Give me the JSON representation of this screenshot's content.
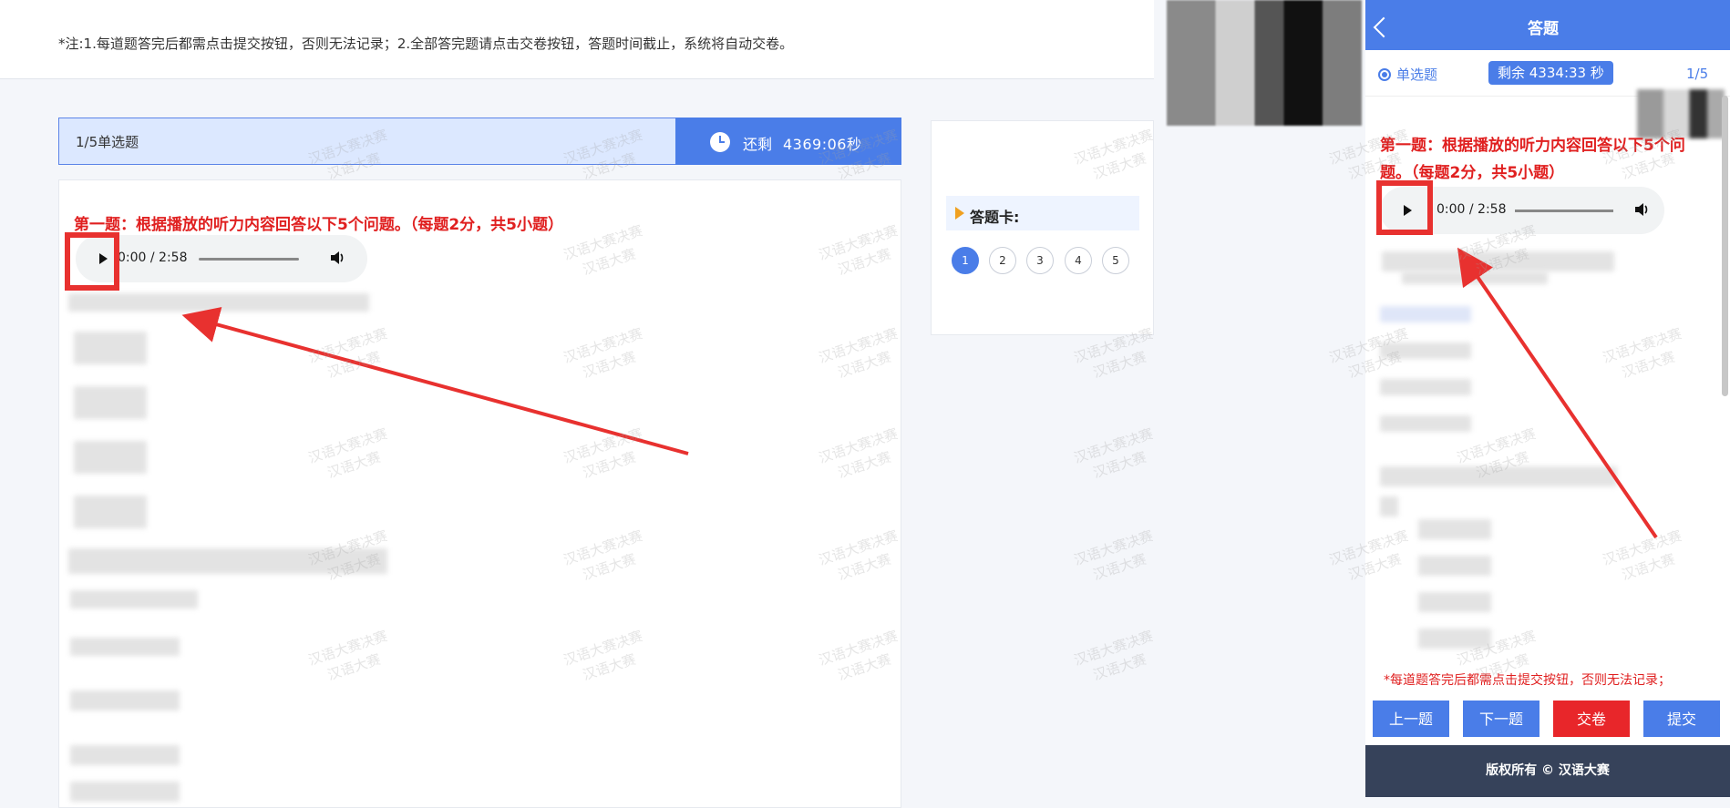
{
  "notice": {
    "text": "*注:1.每道题答完后都需点击提交按钮，否则无法记录；2.全部答完题请点击交卷按钮，答题时间截止，系统将自动交卷。"
  },
  "desktop": {
    "question_type": "1/5单选题",
    "timer_label": "还剩",
    "timer_value": "4369:06秒",
    "question_title": "第一题：根据播放的听力内容回答以下5个问题。（每题2分，共5小题）",
    "audio_time": "0:00 / 2:58",
    "answer_card_title": "答题卡:",
    "answer_card_numbers": [
      "1",
      "2",
      "3",
      "4",
      "5"
    ],
    "active_question": "1"
  },
  "mobile": {
    "header_title": "答题",
    "question_type": "单选题",
    "remaining": "剩余 4334:33 秒",
    "progress": "1/5",
    "question_title": "第一题：根据播放的听力内容回答以下5个问题。（每题2分，共5小题）",
    "audio_time": "0:00 / 2:58",
    "note": "*每道题答完后都需点击提交按钮，否则无法记录；",
    "buttons": {
      "prev": "上一题",
      "next": "下一题",
      "submit_paper": "交卷",
      "submit": "提交"
    },
    "footer": "版权所有 © 汉语大赛"
  },
  "watermark": {
    "line1": "汉语大赛决赛",
    "line2": "汉语大赛"
  },
  "colors": {
    "accent": "#4a7de8",
    "alert_red": "#e02020",
    "submit_red": "#e8262a",
    "footer": "#36425a"
  }
}
